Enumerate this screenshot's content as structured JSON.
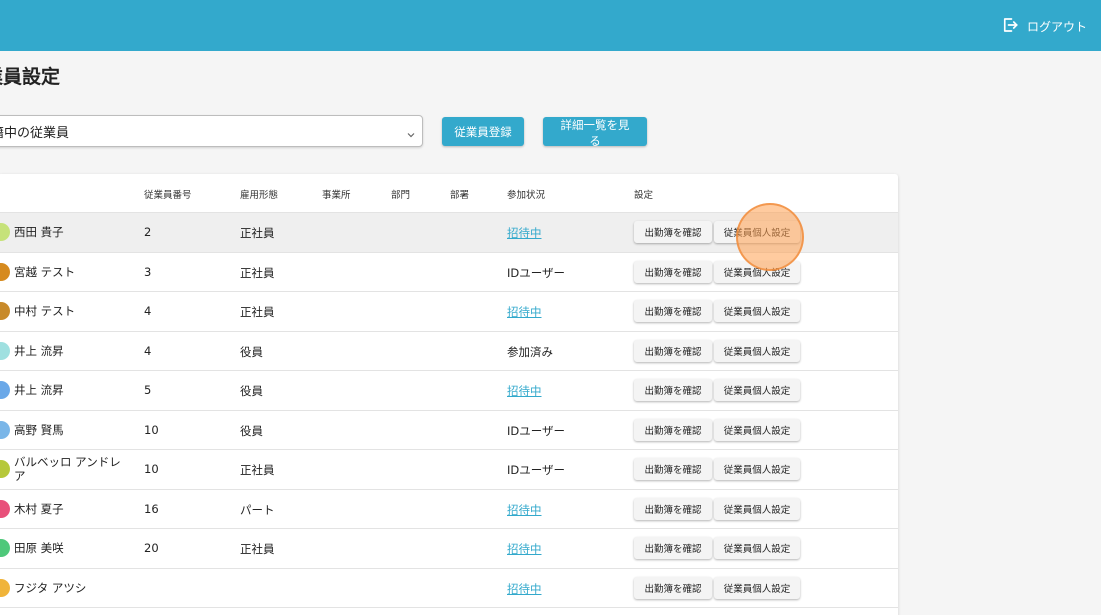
{
  "header": {
    "logout_label": "ログアウト",
    "accent_color": "#33a9cc"
  },
  "page": {
    "title": "業員設定"
  },
  "filter": {
    "selected": "籍中の従業員"
  },
  "actions": {
    "register_label": "従業員登録",
    "details_label": "詳細一覧を見る"
  },
  "table": {
    "columns": [
      "従業員番号",
      "雇用形態",
      "事業所",
      "部門",
      "部署",
      "参加状況",
      "設定"
    ],
    "buttons": {
      "attendance": "出勤簿を確認",
      "personal": "従業員個人設定"
    },
    "rows": [
      {
        "name": "西田 貴子",
        "number": "2",
        "employment": "正社員",
        "status": "招待中",
        "status_link": true,
        "avatar_color": "#c6e27a"
      },
      {
        "name": "宮越 テスト",
        "number": "3",
        "employment": "正社員",
        "status": "IDユーザー",
        "status_link": false,
        "avatar_color": "#d68a1e"
      },
      {
        "name": "中村 テスト",
        "number": "4",
        "employment": "正社員",
        "status": "招待中",
        "status_link": true,
        "avatar_color": "#c88a2a"
      },
      {
        "name": "井上 流昇",
        "number": "4",
        "employment": "役員",
        "status": "参加済み",
        "status_link": false,
        "avatar_color": "#9fe0e0"
      },
      {
        "name": "井上 流昇",
        "number": "5",
        "employment": "役員",
        "status": "招待中",
        "status_link": true,
        "avatar_color": "#6aa8e8"
      },
      {
        "name": "高野 賢馬",
        "number": "10",
        "employment": "役員",
        "status": "IDユーザー",
        "status_link": false,
        "avatar_color": "#7ab6e8"
      },
      {
        "name": "バルベッロ アンドレア",
        "number": "10",
        "employment": "正社員",
        "status": "IDユーザー",
        "status_link": false,
        "avatar_color": "#b6c83a"
      },
      {
        "name": "木村 夏子",
        "number": "16",
        "employment": "パート",
        "status": "招待中",
        "status_link": true,
        "avatar_color": "#e8507a"
      },
      {
        "name": "田原 美咲",
        "number": "20",
        "employment": "正社員",
        "status": "招待中",
        "status_link": true,
        "avatar_color": "#4ec87a"
      },
      {
        "name": "フジタ アツシ",
        "number": "",
        "employment": "",
        "status": "招待中",
        "status_link": true,
        "avatar_color": "#f0b43a"
      }
    ]
  }
}
